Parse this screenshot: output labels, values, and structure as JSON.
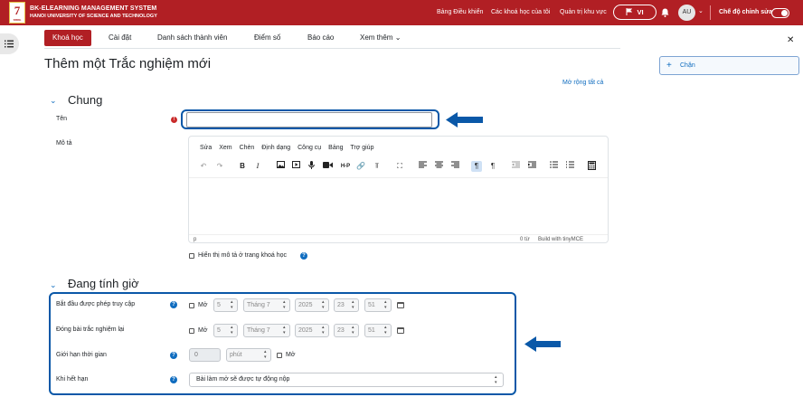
{
  "topbar": {
    "brand_title": "BK-ELEARNING MANAGEMENT SYSTEM",
    "brand_subtitle": "HANOI UNIVERSITY OF SCIENCE AND TECHNOLOGY",
    "nav": [
      "Bảng Điều khiển",
      "Các khoá học của tôi",
      "Quản trị khu vực"
    ],
    "language": "VI",
    "avatar_initials": "AU",
    "edit_mode_label": "Chế độ chỉnh sửa",
    "edit_mode_on": true,
    "accent_color": "#b11f24"
  },
  "tabs": [
    {
      "label": "Khoá học",
      "active": true
    },
    {
      "label": "Cài đặt",
      "active": false
    },
    {
      "label": "Danh sách thành viên",
      "active": false
    },
    {
      "label": "Điểm số",
      "active": false
    },
    {
      "label": "Báo cáo",
      "active": false
    },
    {
      "label": "Xem thêm",
      "active": false
    }
  ],
  "page_title": "Thêm một Trắc nghiệm mới",
  "expand_all": "Mở rộng tất cả",
  "general": {
    "heading": "Chung",
    "name_label": "Tên",
    "name_value": "",
    "description_label": "Mô tả",
    "editor": {
      "menu": [
        "Sửa",
        "Xem",
        "Chèn",
        "Định dạng",
        "Công cụ",
        "Bảng",
        "Trợ giúp"
      ],
      "status_path": "p",
      "word_count": "0 từ",
      "built_with": "Build with tinyMCE"
    },
    "show_description_label": "Hiển thị mô tả ở trang khoá học"
  },
  "timing": {
    "heading": "Đang tính giờ",
    "open_label": "Bắt đầu được phép truy cập",
    "close_label": "Đóng bài trắc nghiệm lại",
    "enable_label": "Mở",
    "day": "5",
    "month": "Tháng 7",
    "year": "2025",
    "hour": "23",
    "minute": "51",
    "limit_label": "Giới hạn thời gian",
    "limit_value": "0",
    "limit_unit": "phút",
    "when_expires_label": "Khi hết hạn",
    "when_expires_value": "Bài làm mở sẽ được tự động nộp"
  },
  "right_drawer": {
    "add_block_label": "Chặn"
  },
  "icons": [
    "list-icon",
    "flag-icon",
    "bell-icon",
    "close-icon",
    "plus-icon",
    "calendar-icon",
    "help-icon",
    "required-icon",
    "arrow-icon"
  ],
  "highlight_color": "#0a58a8"
}
